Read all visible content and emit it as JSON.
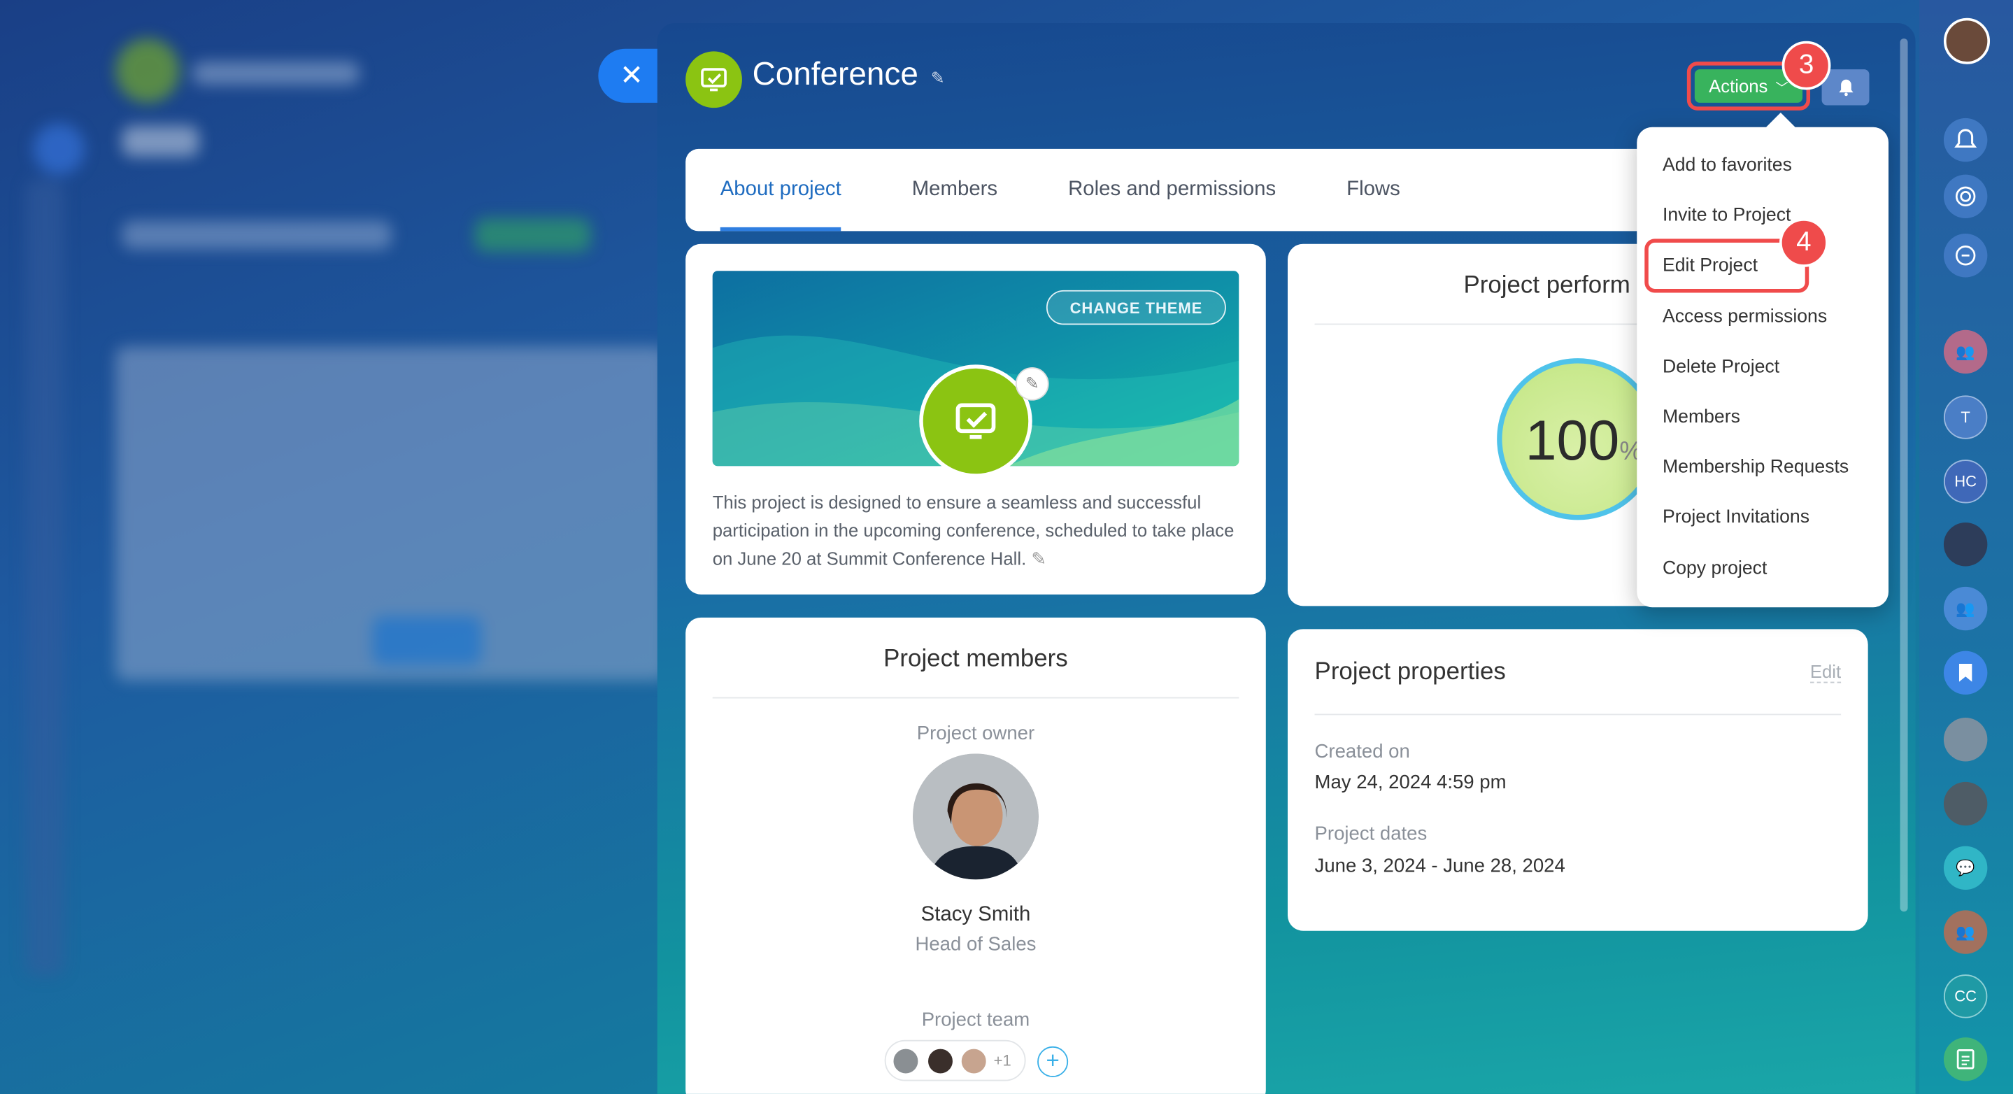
{
  "header": {
    "title": "Conference",
    "actions_label": "Actions"
  },
  "badges": {
    "step3": "3",
    "step4": "4"
  },
  "tabs": [
    {
      "label": "About project"
    },
    {
      "label": "Members"
    },
    {
      "label": "Roles and permissions"
    },
    {
      "label": "Flows"
    }
  ],
  "about": {
    "change_theme": "CHANGE THEME",
    "description": "This project is designed to ensure a seamless and successful participation in the upcoming conference, scheduled to take place on June 20 at Summit Conference Hall."
  },
  "performance": {
    "title": "Project perform",
    "value": "100",
    "unit": "%"
  },
  "menu": [
    {
      "label": "Add to favorites"
    },
    {
      "label": "Invite to Project"
    },
    {
      "label": "Edit Project"
    },
    {
      "label": "Access permissions"
    },
    {
      "label": "Delete Project"
    },
    {
      "label": "Members"
    },
    {
      "label": "Membership Requests"
    },
    {
      "label": "Project Invitations"
    },
    {
      "label": "Copy project"
    }
  ],
  "members": {
    "title": "Project members",
    "owner_label": "Project owner",
    "owner_name": "Stacy Smith",
    "owner_role": "Head of Sales",
    "team_label": "Project team",
    "team_extra": "+1"
  },
  "properties": {
    "title": "Project properties",
    "edit": "Edit",
    "created_label": "Created on",
    "created_value": "May 24, 2024 4:59 pm",
    "dates_label": "Project dates",
    "dates_value": "June 3, 2024 - June 28, 2024"
  },
  "sidebar": {
    "avatar_t": "T",
    "avatar_hc": "HC",
    "avatar_cc": "CC"
  },
  "colors": {
    "accent": "#1f6cc0",
    "actions": "#38b35d",
    "highlight": "#f04b4b",
    "project_icon": "#8bc412"
  }
}
